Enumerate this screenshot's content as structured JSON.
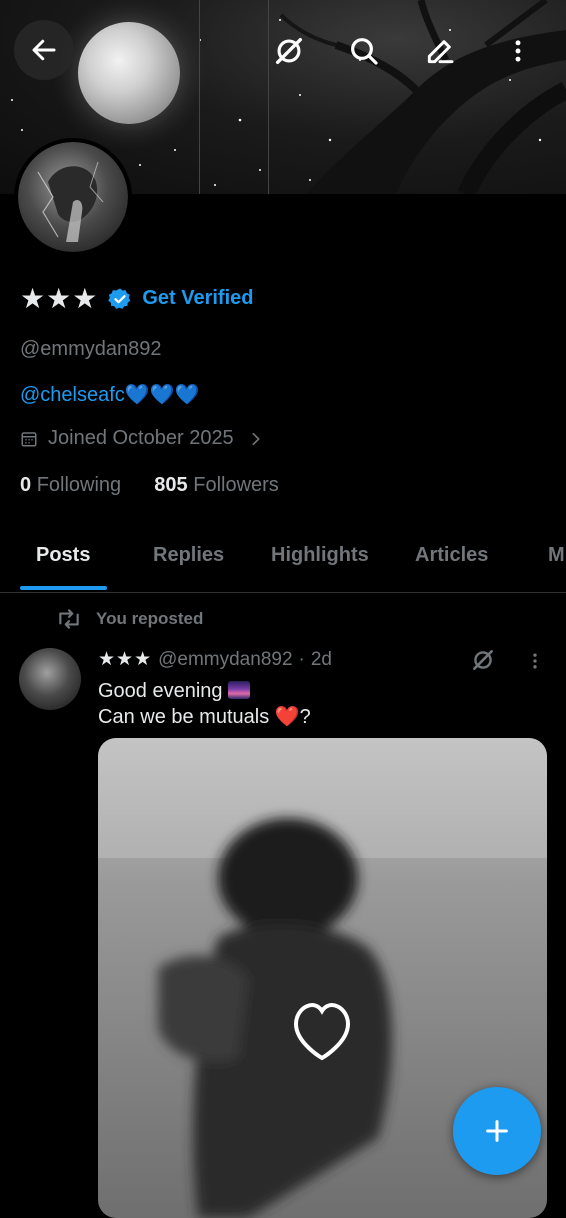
{
  "profile": {
    "display_name": "★★★",
    "get_verified": "Get Verified",
    "handle": "@emmydan892",
    "bio_link": "@chelseafc",
    "bio_hearts": "💙💙💙",
    "joined": "Joined October 2025",
    "following_count": "0",
    "following_label": "Following",
    "followers_count": "805",
    "followers_label": "Followers"
  },
  "tabs": [
    {
      "label": "Posts",
      "active": true
    },
    {
      "label": "Replies"
    },
    {
      "label": "Highlights"
    },
    {
      "label": "Articles"
    },
    {
      "label": "M"
    }
  ],
  "post": {
    "repost_label": "You reposted",
    "author_name": "★★★",
    "author_handle": "@emmydan892",
    "separator": "·",
    "time": "2d",
    "line1": "Good evening",
    "line2_prefix": "Can we be mutuals ",
    "line2_emoji": "❤️",
    "line2_suffix": "?"
  },
  "icons": {
    "back": "arrow-left-icon",
    "grok": "grok-icon",
    "search": "search-icon",
    "edit": "edit-icon",
    "more": "more-vertical-icon",
    "verified": "verified-badge-icon",
    "calendar": "calendar-icon",
    "chevron": "chevron-right-icon",
    "repost": "repost-icon",
    "heart": "heart-outline-icon",
    "compose": "plus-icon"
  },
  "colors": {
    "accent": "#1d9bf0",
    "muted": "#71767b",
    "text": "#e7e9ea",
    "background": "#000000"
  }
}
